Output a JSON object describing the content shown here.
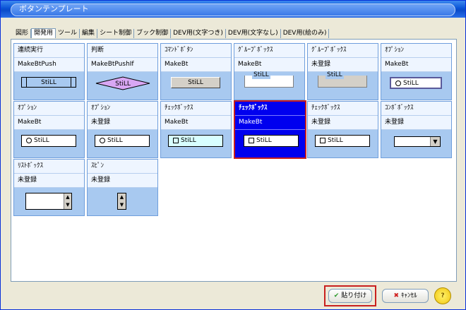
{
  "window": {
    "title": "ボタンテンプレート"
  },
  "tabs": [
    {
      "label": "図形"
    },
    {
      "label": "開発用",
      "active": true
    },
    {
      "label": "ツール"
    },
    {
      "label": "編集"
    },
    {
      "label": "シート制御"
    },
    {
      "label": "ブック制御"
    },
    {
      "label": "DEV用(文字つき)"
    },
    {
      "label": "DEV用(文字なし)"
    },
    {
      "label": "DEV用(絵のみ)"
    }
  ],
  "cells": [
    {
      "title": "連続実行",
      "macro": "MakeBtPush",
      "preview": "StiLL"
    },
    {
      "title": "判断",
      "macro": "MakeBtPushIf",
      "preview": "StiLL"
    },
    {
      "title": "ｺﾏﾝﾄﾞﾎﾞﾀﾝ",
      "macro": "MakeBt",
      "preview": "StiLL"
    },
    {
      "title": "ｸﾞﾙｰﾌﾟﾎﾞｯｸｽ",
      "macro": "MakeBt",
      "preview": "StiLL"
    },
    {
      "title": "ｸﾞﾙｰﾌﾟﾎﾞｯｸｽ",
      "macro": "未登録",
      "preview": "StiLL"
    },
    {
      "title": "ｵﾌﾟｼｮﾝ",
      "macro": "MakeBt",
      "preview": "StiLL"
    },
    {
      "title": "ｵﾌﾟｼｮﾝ",
      "macro": "MakeBt",
      "preview": "StiLL"
    },
    {
      "title": "ｵﾌﾟｼｮﾝ",
      "macro": "未登録",
      "preview": "StiLL"
    },
    {
      "title": "ﾁｪｯｸﾎﾞｯｸｽ",
      "macro": "MakeBt",
      "preview": "StiLL"
    },
    {
      "title": "ﾁｪｯｸﾎﾞｯｸｽ",
      "macro": "MakeBt",
      "preview": "StiLL",
      "selected": true
    },
    {
      "title": "ﾁｪｯｸﾎﾞｯｸｽ",
      "macro": "未登録",
      "preview": "StiLL"
    },
    {
      "title": "ｺﾝﾎﾞﾎﾞｯｸｽ",
      "macro": "未登録",
      "preview": ""
    },
    {
      "title": "ﾘｽﾄﾎﾞｯｸｽ",
      "macro": "未登録",
      "preview": ""
    },
    {
      "title": "ｽﾋﾟﾝ",
      "macro": "未登録",
      "preview": ""
    }
  ],
  "buttons": {
    "paste": "貼り付け",
    "cancel": "ｷｬﾝｾﾙ",
    "help": "?"
  },
  "colors": {
    "selected_bg": "#0000ef",
    "highlight_frame": "#c9201e",
    "cell_bg": "#a8c9f0"
  }
}
